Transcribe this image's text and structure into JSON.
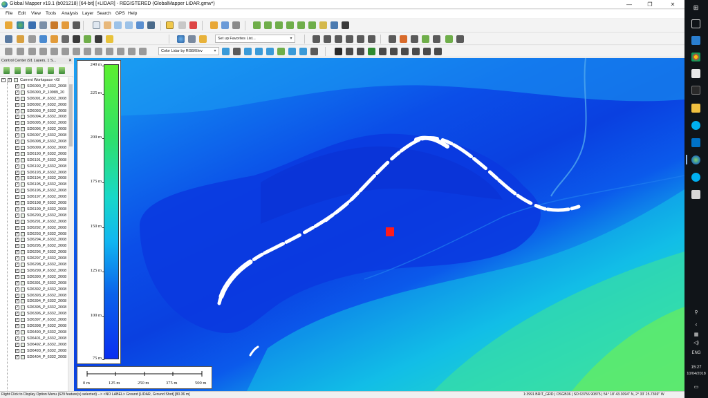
{
  "window": {
    "title": "Global Mapper v19.1 (b021218) [64-bit] [+LIDAR] - REGISTERED (GlobalMapper LiDAR.gmw*)",
    "minimize": "—",
    "maximize": "❐",
    "close": "✕"
  },
  "menu": [
    "File",
    "Edit",
    "View",
    "Tools",
    "Analysis",
    "Layer",
    "Search",
    "GPS",
    "Help"
  ],
  "toolbar": {
    "favorites_combo": "Set up Favorites List...",
    "shader_combo": "Color Lidar by RGB/Elev"
  },
  "control_center": {
    "title": "Control Center (91 Layers, 1 S...",
    "close": "✕",
    "workspace_label": "Current Workspace <Gl",
    "layers": [
      "SD6090_P_6332_2008",
      "SD6090_P_10989_20",
      "SD6091_P_6332_2008",
      "SD6092_P_6332_2008",
      "SD6093_P_6332_2008",
      "SD6094_P_6332_2008",
      "SD6095_P_6332_2008",
      "SD6096_P_6332_2008",
      "SD6097_P_6332_2008",
      "SD6098_P_6332_2008",
      "SD6099_P_6332_2008",
      "SD6190_P_6332_2008",
      "SD6191_P_6332_2008",
      "SD6192_P_6332_2008",
      "SD6193_P_6332_2008",
      "SD6194_P_6332_2008",
      "SD6195_P_6332_2008",
      "SD6196_P_6332_2008",
      "SD6197_P_6332_2008",
      "SD6198_P_6332_2008",
      "SD6199_P_6332_2008",
      "SD6290_P_6332_2008",
      "SD6291_P_6332_2008",
      "SD6292_P_6332_2008",
      "SD6293_P_6332_2008",
      "SD6294_P_6332_2008",
      "SD6295_P_6332_2008",
      "SD6296_P_6332_2008",
      "SD6297_P_6332_2008",
      "SD6298_P_6332_2008",
      "SD6299_P_6332_2008",
      "SD6390_P_6332_2008",
      "SD6391_P_6332_2008",
      "SD6392_P_6332_2008",
      "SD6393_P_6332_2008",
      "SD6394_P_6332_2008",
      "SD6395_P_6332_2008",
      "SD6396_P_6332_2008",
      "SD6397_P_6332_2008",
      "SD6398_P_6332_2008",
      "SD6490_P_6332_2008",
      "SD6401_P_6332_2008",
      "SD6492_P_6332_2008",
      "SD6493_P_6332_2008",
      "SD6404_P_6332_2008"
    ]
  },
  "legend": {
    "labels": [
      "240 m",
      "225 m",
      "200 m",
      "175 m",
      "150 m",
      "125 m",
      "100 m",
      "75 m"
    ],
    "values": [
      240,
      225,
      200,
      175,
      150,
      125,
      100,
      75
    ]
  },
  "scale_bar": {
    "labels": [
      "0 m",
      "125 m",
      "250 m",
      "375 m",
      "500 m"
    ]
  },
  "status": {
    "left": "Right Click to Display Option Menu (629 feature(s) selected) --> <NO LABEL> Ground [LIDAR, Ground Shot] [80.36 m]",
    "right": "1:3991  BRIT_GRD | OSGB36 | SD 63756 90875 | 54° 18' 43.3094\" N, 2° 33' 25.7369\" W"
  },
  "taskbar": {
    "time": "15:27",
    "date": "10/04/2018",
    "lang": "ENG"
  },
  "colors": {
    "accent_red": "#ff1a1a",
    "river_white": "#ffffff",
    "low_blue": "#0a2ff0",
    "high_green": "#5cf02e"
  }
}
